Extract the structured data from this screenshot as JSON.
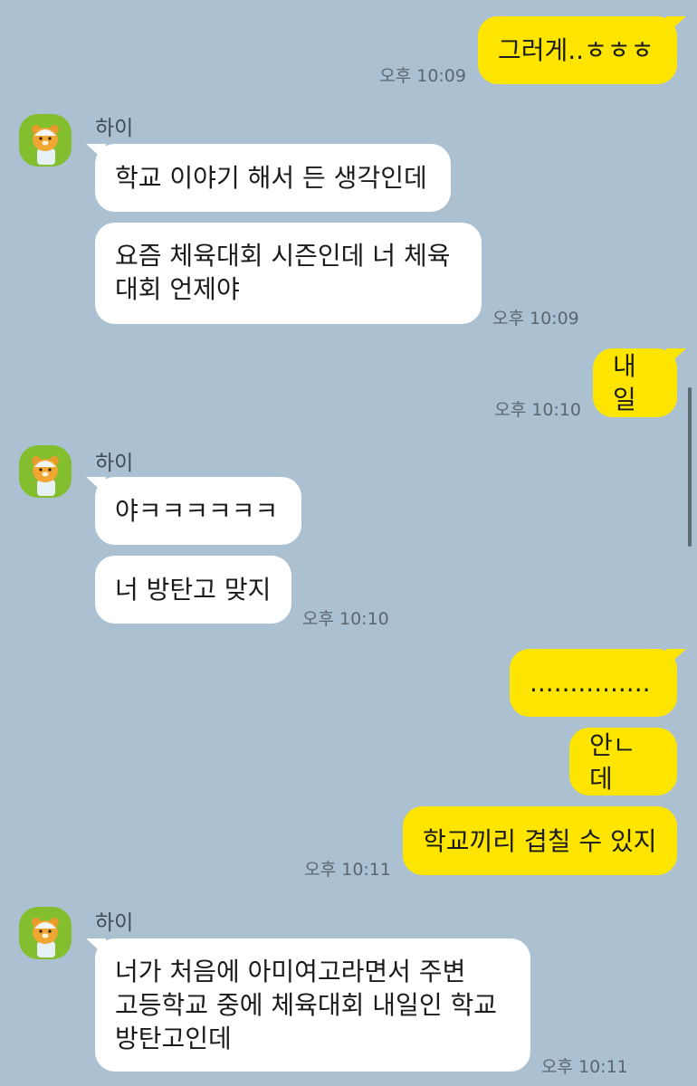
{
  "colors": {
    "background": "#abc1d1",
    "my_bubble": "#fee500",
    "their_bubble": "#ffffff",
    "avatar_bg": "#83be2e"
  },
  "contact": {
    "name": "하이",
    "avatar_icon": "ryan-character-icon"
  },
  "messages": [
    {
      "sender": "me",
      "text": "그러게..ㅎㅎㅎ",
      "time": "오후 10:09"
    },
    {
      "sender": "them",
      "text": "학교 이야기 해서 든 생각인데"
    },
    {
      "sender": "them",
      "text": "요즘 체육대회 시즌인데 너 체육\n대회 언제야",
      "time": "오후 10:09"
    },
    {
      "sender": "me",
      "text": "내일",
      "time": "오후 10:10"
    },
    {
      "sender": "them",
      "text": "야ㅋㅋㅋㅋㅋㅋ"
    },
    {
      "sender": "them",
      "text": "너 방탄고 맞지",
      "time": "오후 10:10"
    },
    {
      "sender": "me",
      "text": "..............."
    },
    {
      "sender": "me",
      "text": "안ㄴ데"
    },
    {
      "sender": "me",
      "text": "학교끼리 겹칠 수 있지",
      "time": "오후 10:11"
    },
    {
      "sender": "them",
      "text": "너가 처음에 아미여고라면서 주변\n고등학교 중에 체육대회 내일인 학교\n방탄고인데",
      "time": "오후 10:11"
    }
  ]
}
